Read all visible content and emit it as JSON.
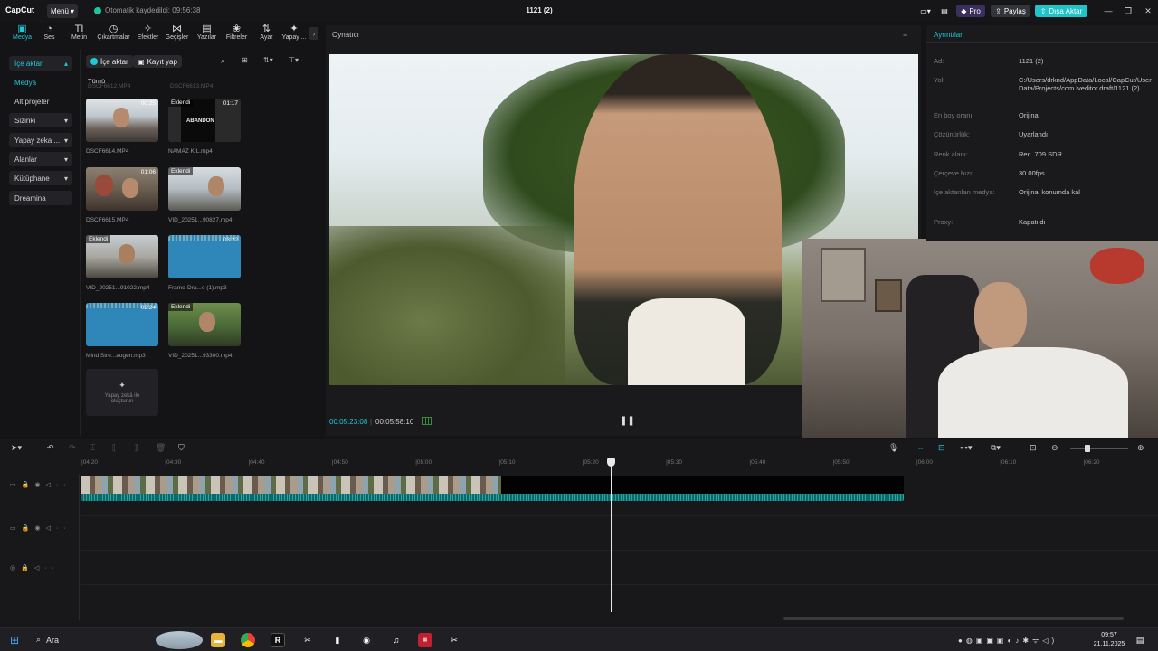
{
  "app": {
    "logo": "CapCut",
    "menu_label": "Menü",
    "autosave_text": "Otomatik kaydedildi: 09:56:38",
    "project_title": "1121 (2)",
    "pro_label": "Pro",
    "share_label": "Paylaş",
    "export_label": "Dışa Aktar",
    "accent_color": "#22c7d6"
  },
  "toolbar": {
    "tools": [
      {
        "label": "Medya",
        "icon": "media-icon"
      },
      {
        "label": "Ses",
        "icon": "audio-icon"
      },
      {
        "label": "Metin",
        "icon": "text-icon"
      },
      {
        "label": "Çıkartmalar",
        "icon": "sticker-icon"
      },
      {
        "label": "Efektler",
        "icon": "effects-icon"
      },
      {
        "label": "Geçişler",
        "icon": "transition-icon"
      },
      {
        "label": "Yazılar",
        "icon": "captions-icon"
      },
      {
        "label": "Filtreler",
        "icon": "filter-icon"
      },
      {
        "label": "Ayar",
        "icon": "adjust-icon"
      },
      {
        "label": "Yapay ...",
        "icon": "ai-icon"
      }
    ]
  },
  "nav": {
    "import_header": "İçe aktar",
    "items": [
      "Medya",
      "Alt projeler"
    ],
    "groups": [
      "Sizinki",
      "Yapay zeka ...",
      "Alanlar",
      "Kütüphane",
      "Dreamina"
    ]
  },
  "media": {
    "import_button": "İçe aktar",
    "record_button": "Kayıt yap",
    "filter_all": "Tümü",
    "top_names": [
      "DSCF6612.MP4",
      "DSCF6613.MP4"
    ],
    "clips": [
      {
        "name": "DSCF6614.MP4",
        "duration": "00:25",
        "badge": ""
      },
      {
        "name": "NAMAZ KIL.mp4",
        "duration": "01:17",
        "badge": "Eklendi",
        "overlay": "ABANDON"
      },
      {
        "name": "DSCF6615.MP4",
        "duration": "01:06",
        "badge": ""
      },
      {
        "name": "VID_20251...90827.mp4",
        "duration": "",
        "badge": "Eklendi"
      },
      {
        "name": "VID_20251...91022.mp4",
        "duration": "",
        "badge": "Eklendi"
      },
      {
        "name": "Frame-Dra...e (1).mp3",
        "duration": "03:22",
        "badge": ""
      },
      {
        "name": "Mind Stre...augen.mp3",
        "duration": "02:24",
        "badge": ""
      },
      {
        "name": "VID_20251...93300.mp4",
        "duration": "",
        "badge": "Eklendi"
      }
    ],
    "ai_create_label": "Yapay zekâ ile oluşturun"
  },
  "player": {
    "title": "Oynatıcı",
    "current_time": "00:05:23:08",
    "total_time": "00:05:58:10"
  },
  "details": {
    "title": "Ayrıntılar",
    "rows": [
      {
        "key": "Ad:",
        "value": "1121 (2)"
      },
      {
        "key": "Yol:",
        "value": "C:/Users/drknd/AppData/Local/CapCut/User Data/Projects/com.lveditor.draft/1121 (2)"
      },
      {
        "key": "En boy oranı:",
        "value": "Orijinal"
      },
      {
        "key": "Çözünürlük:",
        "value": "Uyarlandı"
      },
      {
        "key": "Renk alanı:",
        "value": "Rec. 709 SDR"
      },
      {
        "key": "Çerçeve hızı:",
        "value": "30.00fps"
      },
      {
        "key": "İçe aktarılan medya:",
        "value": "Orijinal konumda kal"
      },
      {
        "key": "Proxy:",
        "value": "Kapatıldı"
      }
    ]
  },
  "timeline": {
    "ruler": [
      "04:20",
      "04:30",
      "04:40",
      "04:50",
      "05:00",
      "05:10",
      "05:20",
      "05:30",
      "05:40",
      "05:50",
      "06:00",
      "06:10",
      "06:20"
    ],
    "playhead_time": "05:23"
  },
  "taskbar": {
    "search_label": "Ara",
    "time": "09:57",
    "date": "21.11.2025"
  }
}
